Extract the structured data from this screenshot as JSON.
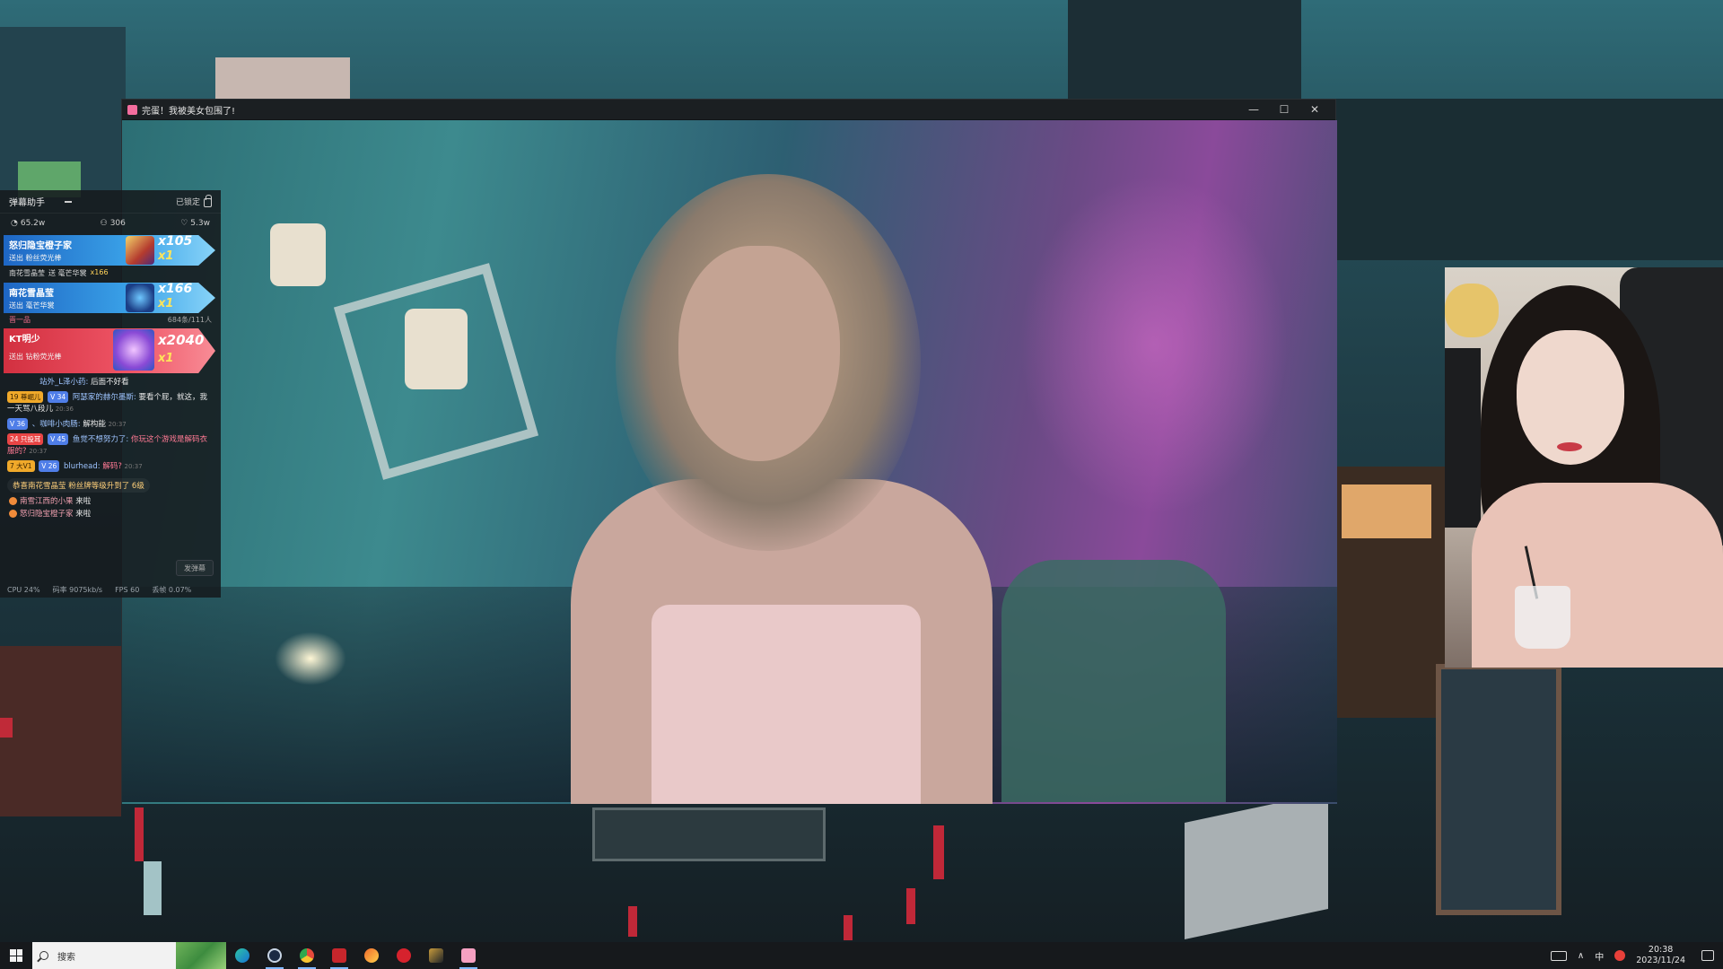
{
  "player": {
    "title": "完蛋！我被美女包围了!",
    "minimize_glyph": "—",
    "maximize_glyph": "☐",
    "close_glyph": "✕"
  },
  "danmaku_panel": {
    "title": "弹幕助手",
    "lock_label": "已锁定",
    "stats": {
      "popularity": "65.2w",
      "viewers": "306",
      "likes": "5.3w"
    },
    "gifts": [
      {
        "name": "怒归隐宝橙子家",
        "sub": "送出  粉丝荧光棒",
        "count": "x105",
        "mult": "x1",
        "style": "blue"
      },
      {
        "name": "南花雪晶莹",
        "sub": "送出  毫芒华裳",
        "count": "x166",
        "mult": "x1",
        "style": "blue"
      },
      {
        "name": "KT明少",
        "sub": "送出  钻粉荧光棒",
        "count": "x2040",
        "mult": "x1",
        "style": "red"
      }
    ],
    "gift_info": {
      "user": "南花雪晶莹",
      "action": "送 毫芒华裳",
      "count": "x166"
    },
    "mini_row": {
      "left": "晋一品",
      "right": "684条/111人"
    },
    "chat": [
      {
        "badges": [],
        "user": "站外_L泽小药:",
        "text": "后面不好看",
        "time": ""
      },
      {
        "badges": [
          {
            "text": "19 尊崛儿",
            "style": "gold"
          },
          {
            "text": "V 34",
            "style": "blue"
          }
        ],
        "user": "阿瑟家的赫尔墨斯:",
        "text": "要看个屁，就这，我一天骂八段儿",
        "time": "20:36"
      },
      {
        "badges": [
          {
            "text": "V 36",
            "style": "blue"
          }
        ],
        "user": "、咖啡小肉肠:",
        "text": "解构能",
        "time": "20:37"
      },
      {
        "badges": [
          {
            "text": "24 只投耳",
            "style": "red"
          },
          {
            "text": "V 45",
            "style": "blue"
          }
        ],
        "user": "鱼觉不想努力了:",
        "text": "你玩这个游戏是解码衣服的?",
        "time": "20:37"
      },
      {
        "badges": [
          {
            "text": "7 大V1",
            "style": "gold"
          },
          {
            "text": "V 26",
            "style": "blue"
          }
        ],
        "user": "blurhead:",
        "text": "解码?",
        "time": "20:37"
      }
    ],
    "notice": "恭喜南花雪晶莹 粉丝牌等级升到了 6级",
    "enters": [
      {
        "user": "南雪江西的小果",
        "action": "来啦"
      },
      {
        "user": "怒归隐宝橙子家",
        "action": "来啦"
      }
    ],
    "danmaku_button": "发弹幕",
    "footer": {
      "cpu": "CPU 24%",
      "bitrate": "码率 9075kb/s",
      "fps": "FPS 60",
      "drop": "丢帧 0.07%"
    }
  },
  "taskbar": {
    "search_placeholder": "搜索",
    "apps": [
      "edge-icon",
      "steam-icon",
      "chrome-icon",
      "app-icon",
      "app2-icon",
      "netease-music-icon",
      "league-icon",
      "live-app-icon"
    ],
    "ime": "中",
    "time": "20:38",
    "date": "2023/11/24"
  },
  "colors": {
    "gift_blue": "#3aa2e8",
    "gift_red": "#ef5566",
    "taskbar": "#16191c"
  }
}
